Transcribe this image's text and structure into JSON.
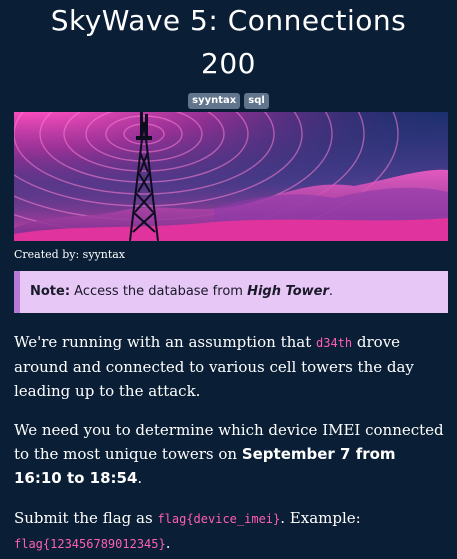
{
  "header": {
    "title_line1": "SkyWave 5: Connections",
    "title_line2": "200"
  },
  "tags": [
    "syyntax",
    "sql"
  ],
  "banner": {
    "description_color_sky": "#1c2f6e",
    "description_color_glow": "#ff2ca8"
  },
  "credit": "Created by: syyntax",
  "note": {
    "label": "Note:",
    "text_before": " Access the database from ",
    "place": "High Tower",
    "text_after": "."
  },
  "body": {
    "p1_before": "We're running with an assumption that ",
    "p1_code": "d34th",
    "p1_after": " drove around and connected to various cell towers the day leading up to the attack.",
    "p2_before": "We need you to determine which device IMEI connected to the most unique towers on ",
    "p2_bold": "September 7 from 16:10 to 18:54",
    "p2_after": ".",
    "p3_before": "Submit the flag as ",
    "p3_code1": "flag{device_imei}",
    "p3_mid": ". Example: ",
    "p3_code2": "flag{123456789012345}",
    "p3_after": "."
  },
  "colors": {
    "background": "#0a1e36",
    "tag_bg": "#61758d",
    "note_bg": "#e7c7f5",
    "note_border": "#b57ad8",
    "code": "#ff5fb5"
  }
}
